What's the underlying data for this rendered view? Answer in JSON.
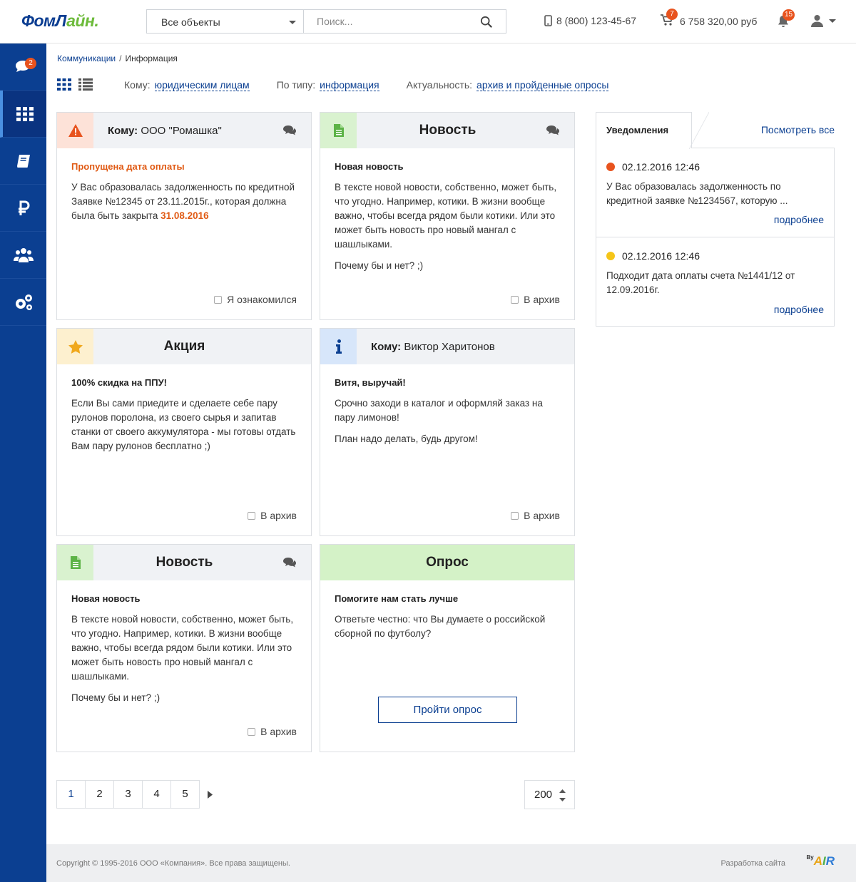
{
  "header": {
    "logo_part1": "ФомЛ",
    "logo_part2": "айн.",
    "objects_select": "Все объекты",
    "search_placeholder": "Поиск...",
    "phone": "8 (800) 123-45-67",
    "cart_count": "7",
    "cart_total": "6 758 320,00 руб",
    "notifications_count": "15"
  },
  "sidebar": {
    "items": [
      {
        "icon": "chat-icon",
        "badge": "2"
      },
      {
        "icon": "grid-icon",
        "active": true
      },
      {
        "icon": "book-icon"
      },
      {
        "icon": "ruble-icon"
      },
      {
        "icon": "users-icon"
      },
      {
        "icon": "settings-icon"
      }
    ]
  },
  "breadcrumb": {
    "parent": "Коммуникации",
    "separator": "/",
    "current": "Информация"
  },
  "filters": {
    "to_label": "Кому:",
    "to_value": "юридическим лицам",
    "type_label": "По типу:",
    "type_value": "информация",
    "actual_label": "Актуальность:",
    "actual_value": "архив и пройденные опросы"
  },
  "cards": [
    {
      "to_label": "Кому:",
      "to_name": "ООО \"Ромашка\"",
      "subtitle": "Пропущена дата оплаты",
      "text1": "У Вас образовалась задолженность по кредитной Заявке №12345 от 23.11.2015г., которая должна была быть закрыта",
      "date": "31.08.2016",
      "footer": "Я ознакомился"
    },
    {
      "title": "Новость",
      "subtitle": "Новая новость",
      "text1": "В тексте новой новости, собственно, может быть, что угодно. Например, котики. В жизни вообще важно, чтобы всегда рядом были котики. Или это может быть новость про новый мангал с шашлыками.",
      "text2": "Почему бы и нет? ;)",
      "footer": "В архив"
    },
    {
      "title": "Акция",
      "subtitle": "100% скидка на ППУ!",
      "text1": "Если Вы  сами приедите и сделаете себе пару рулонов поролона, из своего сырья и запитав станки от своего аккумулятора - мы готовы отдать Вам пару рулонов бесплатно ;)",
      "footer": "В архив"
    },
    {
      "to_label": "Кому:",
      "to_name": "Виктор Харитонов",
      "subtitle": "Витя, выручай!",
      "text1": "Срочно заходи в каталог и оформляй заказ на пару лимонов!",
      "text2": "План надо делать, будь другом!",
      "footer": "В архив"
    },
    {
      "title": "Новость",
      "subtitle": "Новая новость",
      "text1": "В тексте новой новости, собственно, может быть, что угодно. Например, котики. В жизни вообще важно, чтобы всегда рядом были котики. Или это может быть новость про новый мангал с шашлыками.",
      "text2": "Почему бы и нет? ;)",
      "footer": "В архив"
    },
    {
      "title": "Опрос",
      "subtitle": "Помогите нам стать лучше",
      "text1": "Ответьте честно: что Вы думаете о российской сборной по футболу?",
      "button": "Пройти опрос"
    }
  ],
  "notifications": {
    "tab": "Уведомления",
    "view_all": "Посмотреть все",
    "items": [
      {
        "color": "#e8531e",
        "date": "02.12.2016 12:46",
        "text": "У Вас образовалась задолженность по кредитной заявке №1234567, которую ...",
        "more": "подробнее"
      },
      {
        "color": "#f5c518",
        "date": "02.12.2016 12:46",
        "text": "Подходит дата оплаты счета №1441/12 от 12.09.2016г.",
        "more": "подробнее"
      }
    ]
  },
  "pagination": {
    "pages": [
      "1",
      "2",
      "3",
      "4",
      "5"
    ],
    "current": "1",
    "per_page": "200"
  },
  "footer": {
    "copyright": "Copyright © 1995-2016 ООО «Компания». Все права защищены.",
    "dev_label": "Разработка сайта",
    "dev_by": "By",
    "dev_logo": "AIR"
  },
  "colors": {
    "brand": "#0b3f91",
    "accent_green": "#6dbb3b",
    "warning": "#e05a14",
    "sidebar": "#0b3f91"
  }
}
